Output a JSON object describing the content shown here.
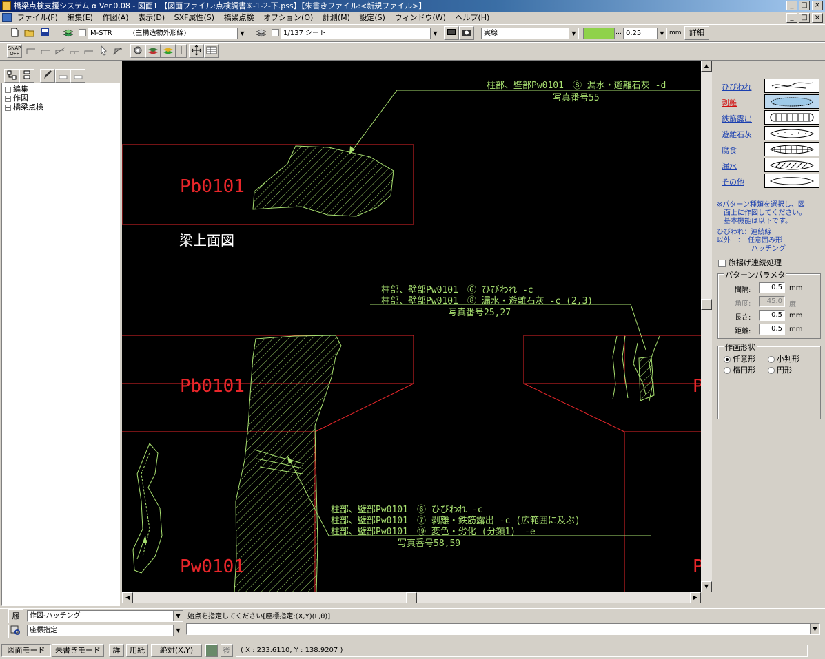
{
  "window": {
    "title": "橋梁点検支援システム α Ver.0.08 - 図面1 【図面ファイル:点検調書⑤-1-2-下.pss】【朱書きファイル:<新規ファイル>】",
    "minimize": "_",
    "maximize": "□",
    "close": "×"
  },
  "menu": [
    "ファイル(F)",
    "編集(E)",
    "作図(A)",
    "表示(D)",
    "SXF属性(S)",
    "橋梁点検",
    "オプション(O)",
    "計測(M)",
    "設定(S)",
    "ウィンドウ(W)",
    "ヘルプ(H)"
  ],
  "toolbar": {
    "layer_combo": "M-STR　　　(主構造物外形線)",
    "sheet_combo": "1/137 シート",
    "linetype_combo": "実線",
    "line_color": "#8fd24a",
    "line_width": "0.25",
    "unit": "mm",
    "detail_button": "詳細",
    "snap_label": "SNAP\nOFF"
  },
  "tree": {
    "items": [
      "編集",
      "作図",
      "橋梁点検"
    ]
  },
  "canvas": {
    "labels": {
      "pb1": "Pb0101",
      "pb2": "Pb0101",
      "pw1": "Pw0101",
      "edge1": "P",
      "edge2": "P",
      "caption": "梁上面図"
    },
    "annotations": {
      "a1_line1": "柱部、壁部Pw0101　⑧ 漏水・遊離石灰 -d",
      "a1_line2": "写真番号55",
      "a2_line1": "柱部、壁部Pw0101　⑥ ひびわれ -c",
      "a2_line2": "柱部、壁部Pw0101　⑧ 漏水・遊離石灰 -c (2,3)",
      "a2_line3": "写真番号25,27",
      "a3_line1": "柱部、壁部Pw0101　⑥ ひびわれ -c",
      "a3_line2": "柱部、壁部Pw0101　⑦ 剥離・鉄筋露出 -c (広範囲に及ぶ)",
      "a3_line3": "柱部、壁部Pw0101　⑲ 変色・劣化 (分類1)　-e",
      "a3_line4": "写真番号58,59"
    },
    "colors": {
      "red": "#e8262a",
      "green": "#a8e070",
      "white": "#ffffff"
    }
  },
  "patterns": [
    {
      "label": "ひびわれ",
      "selected": false
    },
    {
      "label": "剥離",
      "selected": true
    },
    {
      "label": "鉄筋露出",
      "selected": false
    },
    {
      "label": "遊離石灰",
      "selected": false
    },
    {
      "label": "腐食",
      "selected": false
    },
    {
      "label": "漏水",
      "selected": false
    },
    {
      "label": "その他",
      "selected": false
    }
  ],
  "help": {
    "line1": "※パターン種類を選択し、図",
    "line2": "　面上に作図してください。",
    "line3": "　基本機能は以下です。",
    "line4": "ひびわれ：連続線",
    "line5": "以外　：　任意囲み形",
    "line6": "　　　　　ハッチング"
  },
  "flag_checkbox": "旗揚げ連続処理",
  "params": {
    "title": "パターンパラメタ",
    "spacing_label": "間隔:",
    "spacing": "0.5",
    "angle_label": "角度:",
    "angle": "45.0",
    "length_label": "長さ:",
    "length": "0.5",
    "distance_label": "距離:",
    "distance": "0.5",
    "unit_mm": "mm",
    "unit_deg": "度"
  },
  "shape": {
    "title": "作画形状",
    "opt1": "任意形",
    "opt2": "小判形",
    "opt3": "楕円形",
    "opt4": "円形",
    "selected": "任意形"
  },
  "command": {
    "history_btn": "履",
    "mode_combo": "作図-ハッチング",
    "input_combo": "座標指定",
    "prompt": "始点を指定してください[座標指定:(X,Y)(L,θ)]",
    "input_value": ""
  },
  "statusbar": {
    "drawing_mode": "図面モード",
    "redline_mode": "朱書きモード",
    "detail": "詳",
    "paper": "用紙",
    "absolute": "絶対(X,Y)",
    "back": "後",
    "coords": "( X : 233.6110, Y : 138.9207 )"
  }
}
